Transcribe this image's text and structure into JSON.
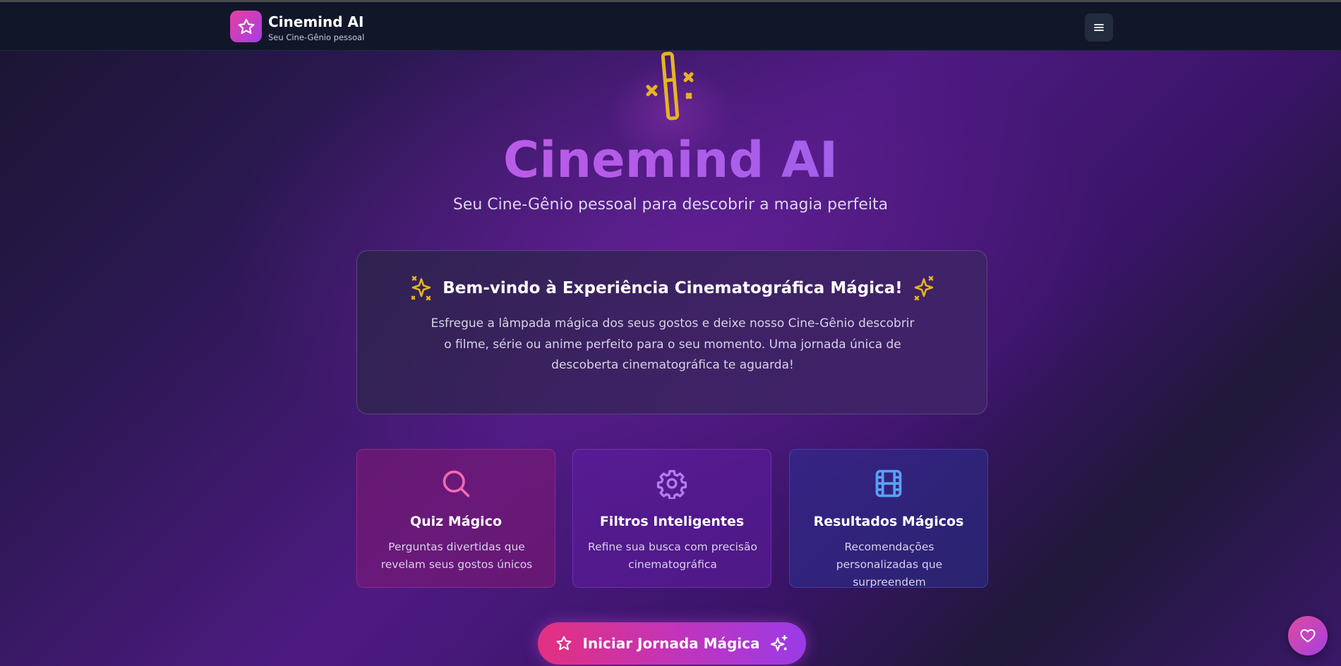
{
  "header": {
    "brand_title": "Cinemind AI",
    "brand_subtitle": "Seu Cine-Gênio pessoal",
    "logo_icon": "star-icon",
    "menu_icon": "hamburger-menu-icon"
  },
  "hero": {
    "icon": "magic-wand-icon",
    "title": "Cinemind AI",
    "subtitle": "Seu Cine-Gênio pessoal para descobrir a magia perfeita"
  },
  "welcome": {
    "icon": "sparkles-icon",
    "title": "Bem-vindo à Experiência Cinematográfica Mágica!",
    "body": "Esfregue a lâmpada mágica dos seus gostos e deixe nosso Cine-Gênio descobrir o filme, série ou anime perfeito para o seu momento. Uma jornada única de descoberta cinematográfica te aguarda!"
  },
  "features": [
    {
      "icon": "search-icon",
      "title": "Quiz Mágico",
      "description": "Perguntas divertidas que revelam seus gostos únicos"
    },
    {
      "icon": "gear-icon",
      "title": "Filtros Inteligentes",
      "description": "Refine sua busca com precisão cinematográfica"
    },
    {
      "icon": "film-icon",
      "title": "Resultados Mágicos",
      "description": "Recomendações personalizadas que surpreendem"
    }
  ],
  "cta": {
    "label": "Iniciar Jornada Mágica",
    "left_icon": "star-icon",
    "right_icon": "sparkles-icon"
  },
  "fab": {
    "icon": "heart-icon"
  },
  "colors": {
    "header_bg": "#111729",
    "accent_pink": "#e3307e",
    "accent_purple": "#9b3be8",
    "gold": "#e6b422",
    "search_icon": "#f06ab0",
    "gear_icon": "#b57cf0",
    "film_icon": "#5aa0f5"
  }
}
